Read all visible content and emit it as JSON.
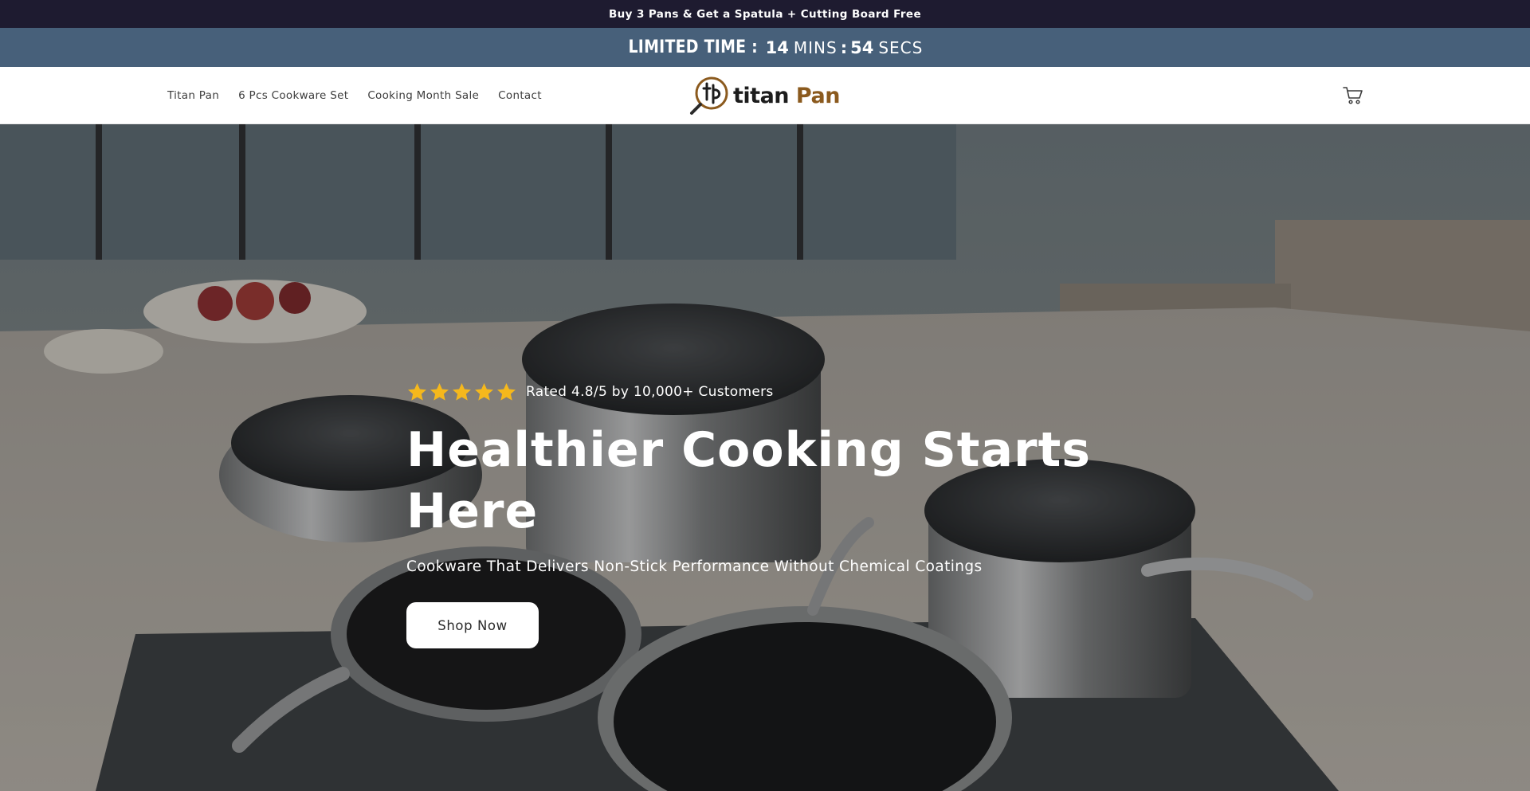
{
  "announcement": {
    "text": "Buy 3 Pans & Get a Spatula + Cutting Board Free"
  },
  "countdown": {
    "label": "LIMITED TIME :",
    "minutes": "14",
    "minutes_unit": "MINS",
    "separator": ":",
    "seconds": "54",
    "seconds_unit": "SECS"
  },
  "header": {
    "nav": [
      {
        "label": "Titan Pan"
      },
      {
        "label": "6 Pcs Cookware Set"
      },
      {
        "label": "Cooking Month Sale"
      },
      {
        "label": "Contact"
      }
    ],
    "logo": {
      "word1": "titan",
      "word2": "Pan"
    },
    "cart_icon": "cart-icon"
  },
  "hero": {
    "rating": {
      "stars": 5,
      "text": "Rated 4.8/5 by 10,000+ Customers"
    },
    "title": "Healthier Cooking Starts Here",
    "subtitle": "Cookware That Delivers Non-Stick Performance Without Chemical Coatings",
    "cta_label": "Shop Now"
  },
  "colors": {
    "announcement_bg": "#1e1b30",
    "countdown_bg": "#47607a",
    "logo_accent": "#8b5a1e",
    "star": "#f5b81c"
  }
}
